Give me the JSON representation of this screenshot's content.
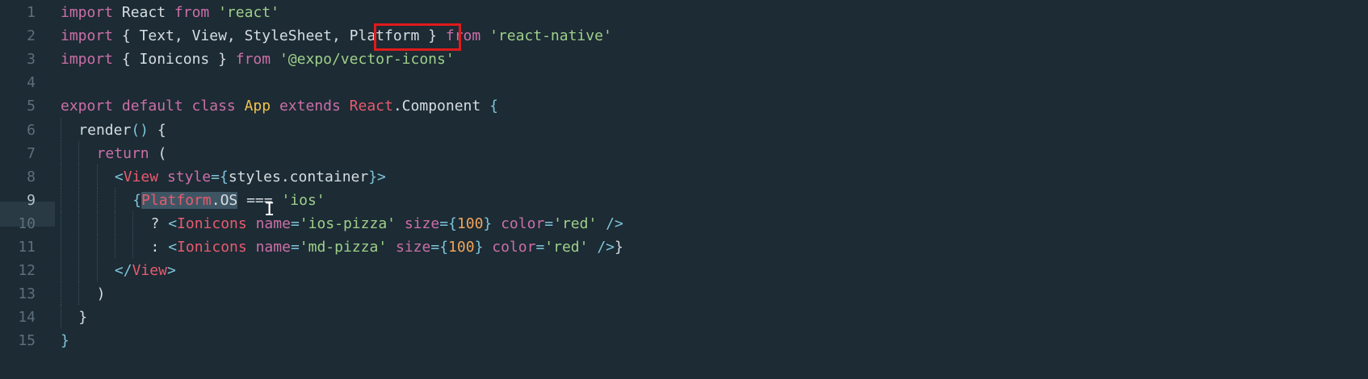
{
  "editor": {
    "language": "javascript",
    "active_line": 9,
    "highlighted_token": "Platform",
    "selection_text": "Platform.OS",
    "lines": [
      {
        "number": "1",
        "tokens": [
          [
            "kw",
            "import"
          ],
          [
            "def",
            " React "
          ],
          [
            "kw",
            "from"
          ],
          [
            "def",
            " "
          ],
          [
            "str",
            "'react'"
          ]
        ]
      },
      {
        "number": "2",
        "tokens": [
          [
            "kw",
            "import"
          ],
          [
            "def",
            " { Text, View, StyleSheet, "
          ],
          [
            "def",
            "Platform"
          ],
          [
            "def",
            " } "
          ],
          [
            "kw",
            "from"
          ],
          [
            "def",
            " "
          ],
          [
            "str",
            "'react-native'"
          ]
        ]
      },
      {
        "number": "3",
        "tokens": [
          [
            "kw",
            "import"
          ],
          [
            "def",
            " { Ionicons } "
          ],
          [
            "kw",
            "from"
          ],
          [
            "def",
            " "
          ],
          [
            "str",
            "'@expo/vector-icons'"
          ]
        ]
      },
      {
        "number": "4",
        "tokens": []
      },
      {
        "number": "5",
        "tokens": [
          [
            "kw",
            "export default class"
          ],
          [
            "def",
            " "
          ],
          [
            "cls",
            "App"
          ],
          [
            "def",
            " "
          ],
          [
            "kw",
            "extends"
          ],
          [
            "def",
            " "
          ],
          [
            "tag",
            "React"
          ],
          [
            "def",
            ".Component "
          ],
          [
            "pun",
            "{"
          ]
        ]
      },
      {
        "number": "6",
        "tokens": [
          [
            "def",
            "render"
          ],
          [
            "pun",
            "()"
          ],
          [
            "def",
            " {"
          ]
        ]
      },
      {
        "number": "7",
        "tokens": [
          [
            "kw",
            "return"
          ],
          [
            "def",
            " ("
          ]
        ]
      },
      {
        "number": "8",
        "tokens": [
          [
            "pun",
            "<"
          ],
          [
            "tag",
            "View"
          ],
          [
            "def",
            " "
          ],
          [
            "attr",
            "style"
          ],
          [
            "pun",
            "={"
          ],
          [
            "def",
            "styles.container"
          ],
          [
            "pun",
            "}>"
          ]
        ]
      },
      {
        "number": "9",
        "tokens": [
          [
            "pun",
            "{"
          ],
          [
            "seltag",
            "Platform"
          ],
          [
            "sel",
            ".OS"
          ],
          [
            "def",
            " === "
          ],
          [
            "str",
            "'ios'"
          ]
        ]
      },
      {
        "number": "10",
        "tokens": [
          [
            "def",
            "? "
          ],
          [
            "pun",
            "<"
          ],
          [
            "tag",
            "Ionicons"
          ],
          [
            "def",
            " "
          ],
          [
            "attr",
            "name"
          ],
          [
            "pun",
            "="
          ],
          [
            "str",
            "'ios-pizza'"
          ],
          [
            "def",
            " "
          ],
          [
            "attr",
            "size"
          ],
          [
            "pun",
            "={"
          ],
          [
            "num",
            "100"
          ],
          [
            "pun",
            "}"
          ],
          [
            "def",
            " "
          ],
          [
            "attr",
            "color"
          ],
          [
            "pun",
            "="
          ],
          [
            "str",
            "'red'"
          ],
          [
            "def",
            " "
          ],
          [
            "pun",
            "/>"
          ]
        ]
      },
      {
        "number": "11",
        "tokens": [
          [
            "def",
            ": "
          ],
          [
            "pun",
            "<"
          ],
          [
            "tag",
            "Ionicons"
          ],
          [
            "def",
            " "
          ],
          [
            "attr",
            "name"
          ],
          [
            "pun",
            "="
          ],
          [
            "str",
            "'md-pizza'"
          ],
          [
            "def",
            " "
          ],
          [
            "attr",
            "size"
          ],
          [
            "pun",
            "={"
          ],
          [
            "num",
            "100"
          ],
          [
            "pun",
            "}"
          ],
          [
            "def",
            " "
          ],
          [
            "attr",
            "color"
          ],
          [
            "pun",
            "="
          ],
          [
            "str",
            "'red'"
          ],
          [
            "def",
            " "
          ],
          [
            "pun",
            "/>"
          ],
          [
            "def",
            "}"
          ]
        ]
      },
      {
        "number": "12",
        "tokens": [
          [
            "pun",
            "</"
          ],
          [
            "tag",
            "View"
          ],
          [
            "pun",
            ">"
          ]
        ]
      },
      {
        "number": "13",
        "tokens": [
          [
            "def",
            ")"
          ]
        ]
      },
      {
        "number": "14",
        "tokens": [
          [
            "def",
            "}"
          ]
        ]
      },
      {
        "number": "15",
        "tokens": [
          [
            "pun",
            "}"
          ]
        ]
      }
    ]
  },
  "colors": {
    "background": "#1c2b34",
    "keyword": "#cc6fa8",
    "string": "#9fcf8a",
    "number": "#f1a45a",
    "class_name": "#f2c14e",
    "tag": "#e95a6f",
    "highlight_box": "#e01b1b"
  }
}
